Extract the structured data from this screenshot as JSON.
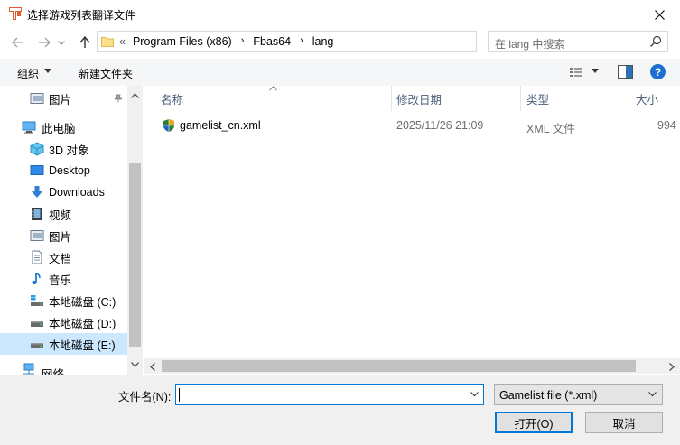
{
  "window": {
    "title": "选择游戏列表翻译文件"
  },
  "address": {
    "overflow": "«",
    "crumbs": [
      "Program Files (x86)",
      "Fbas64",
      "lang"
    ],
    "separator": "›"
  },
  "search": {
    "placeholder": "在 lang 中搜索"
  },
  "toolbar": {
    "organize_label": "组织",
    "new_folder_label": "新建文件夹"
  },
  "nav": {
    "items": [
      {
        "label": "图片",
        "icon": "pictures-icon"
      },
      {
        "label": "此电脑",
        "icon": "computer-icon"
      },
      {
        "label": "3D 对象",
        "icon": "3d-objects-icon"
      },
      {
        "label": "Desktop",
        "icon": "desktop-icon"
      },
      {
        "label": "Downloads",
        "icon": "downloads-icon"
      },
      {
        "label": "视频",
        "icon": "videos-icon"
      },
      {
        "label": "图片",
        "icon": "pictures-icon"
      },
      {
        "label": "文档",
        "icon": "documents-icon"
      },
      {
        "label": "音乐",
        "icon": "music-icon"
      },
      {
        "label": "本地磁盘 (C:)",
        "icon": "system-drive-icon"
      },
      {
        "label": "本地磁盘 (D:)",
        "icon": "drive-icon"
      },
      {
        "label": "本地磁盘 (E:)",
        "icon": "drive-icon"
      },
      {
        "label": "网络",
        "icon": "network-icon"
      }
    ]
  },
  "list": {
    "columns": [
      "名称",
      "修改日期",
      "类型",
      "大小"
    ],
    "rows": [
      {
        "name": "gamelist_cn.xml",
        "modified": "2025/11/26 21:09",
        "type": "XML 文件",
        "size": "994"
      }
    ]
  },
  "footer": {
    "filename_label": "文件名(N):",
    "filename_value": "",
    "filetype_selected": "Gamelist file (*.xml)",
    "open_label": "打开(O)",
    "cancel_label": "取消"
  },
  "colors": {
    "accent": "#0078d7",
    "selection": "#cce8ff",
    "header_text": "#4c607a"
  }
}
